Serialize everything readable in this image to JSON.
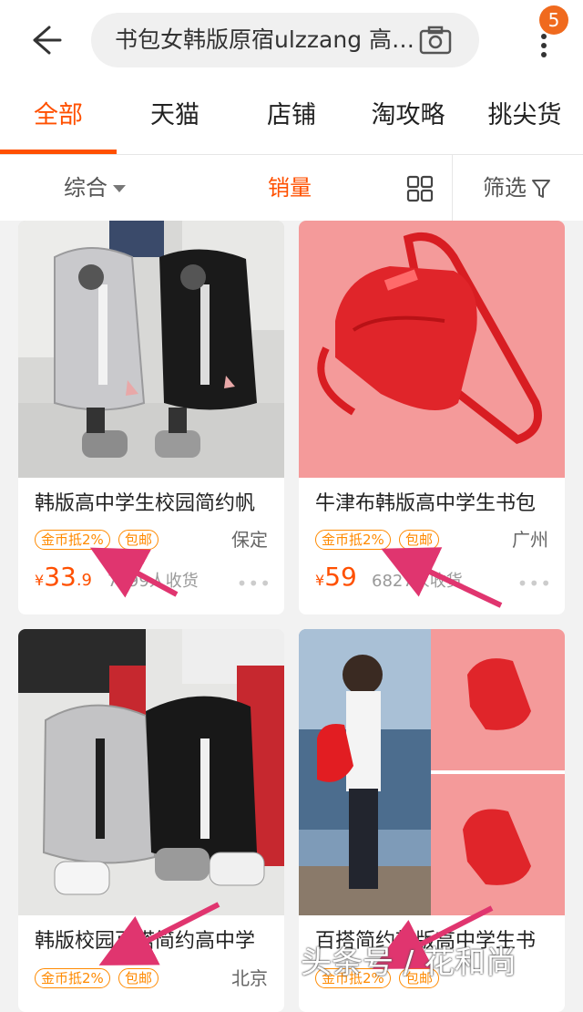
{
  "header": {
    "search_text": "书包女韩版原宿ulzzang 高…",
    "notification_count": "5"
  },
  "tabs": [
    {
      "label": "全部",
      "active": true
    },
    {
      "label": "天猫"
    },
    {
      "label": "店铺"
    },
    {
      "label": "淘攻略"
    },
    {
      "label": "挑尖货"
    }
  ],
  "sortbar": {
    "comprehensive": "综合",
    "sales": "销量",
    "filter": "筛选"
  },
  "products": [
    {
      "title": "韩版高中学生校园简约帆",
      "tag1": "金币抵2%",
      "tag2": "包邮",
      "location": "保定",
      "price_int": "33",
      "price_dec": ".9",
      "currency": "¥",
      "sales": "7299人收货",
      "image": "gray-and-black-backpacks"
    },
    {
      "title": "牛津布韩版高中学生书包",
      "tag1": "金币抵2%",
      "tag2": "包邮",
      "location": "广州",
      "price_int": "59",
      "price_dec": "",
      "currency": "¥",
      "sales": "6827人收货",
      "image": "red-mini-backpack"
    },
    {
      "title": "韩版校园百搭简约高中学",
      "tag1": "金币抵2%",
      "tag2": "包邮",
      "location": "北京",
      "image": "xiang-backpacks"
    },
    {
      "title": "百搭简约韩版高中学生书",
      "tag1": "金币抵2%",
      "tag2": "包邮",
      "location": "",
      "image": "girl-with-red-backpack"
    }
  ],
  "watermark": "头条号 / 花和尚",
  "colors": {
    "accent": "#ff5000",
    "tag": "#ff8a00",
    "arrow": "#e0356f"
  }
}
